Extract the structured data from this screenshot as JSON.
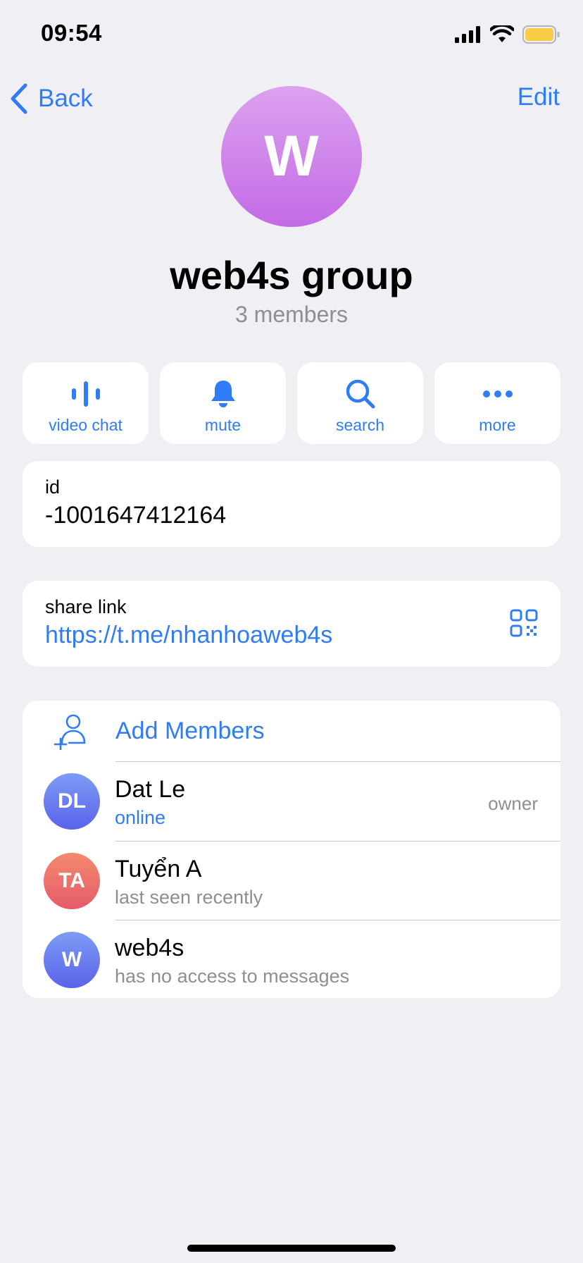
{
  "status_bar": {
    "time": "09:54",
    "battery_color": "#f7cd46"
  },
  "nav": {
    "back_label": "Back",
    "edit_label": "Edit"
  },
  "group": {
    "avatar_letter": "W",
    "title": "web4s group",
    "subtitle": "3 members"
  },
  "actions": [
    {
      "label": "video chat",
      "icon": "voice-chat-icon"
    },
    {
      "label": "mute",
      "icon": "bell-icon"
    },
    {
      "label": "search",
      "icon": "search-icon"
    },
    {
      "label": "more",
      "icon": "more-dots-icon"
    }
  ],
  "info": {
    "id_label": "id",
    "id_value": "-1001647412164",
    "link_label": "share link",
    "link_value": "https://t.me/nhanhoaweb4s"
  },
  "members": {
    "add_label": "Add Members",
    "list": [
      {
        "initials": "DL",
        "name": "Dat Le",
        "status": "online",
        "role": "owner",
        "color_top": "#7d9cf5",
        "color_bottom": "#5a63ea"
      },
      {
        "initials": "TA",
        "name": "Tuyển A",
        "status": "last seen recently",
        "role": "",
        "color_top": "#f28a6e",
        "color_bottom": "#e65a6a"
      },
      {
        "initials": "W",
        "name": "web4s",
        "status": "has no access to messages",
        "role": "",
        "color_top": "#7d9cf5",
        "color_bottom": "#5a63ea"
      }
    ]
  },
  "colors": {
    "accent": "#2f7cf6",
    "background": "#efeff4",
    "group_avatar": "#c36ae5"
  }
}
